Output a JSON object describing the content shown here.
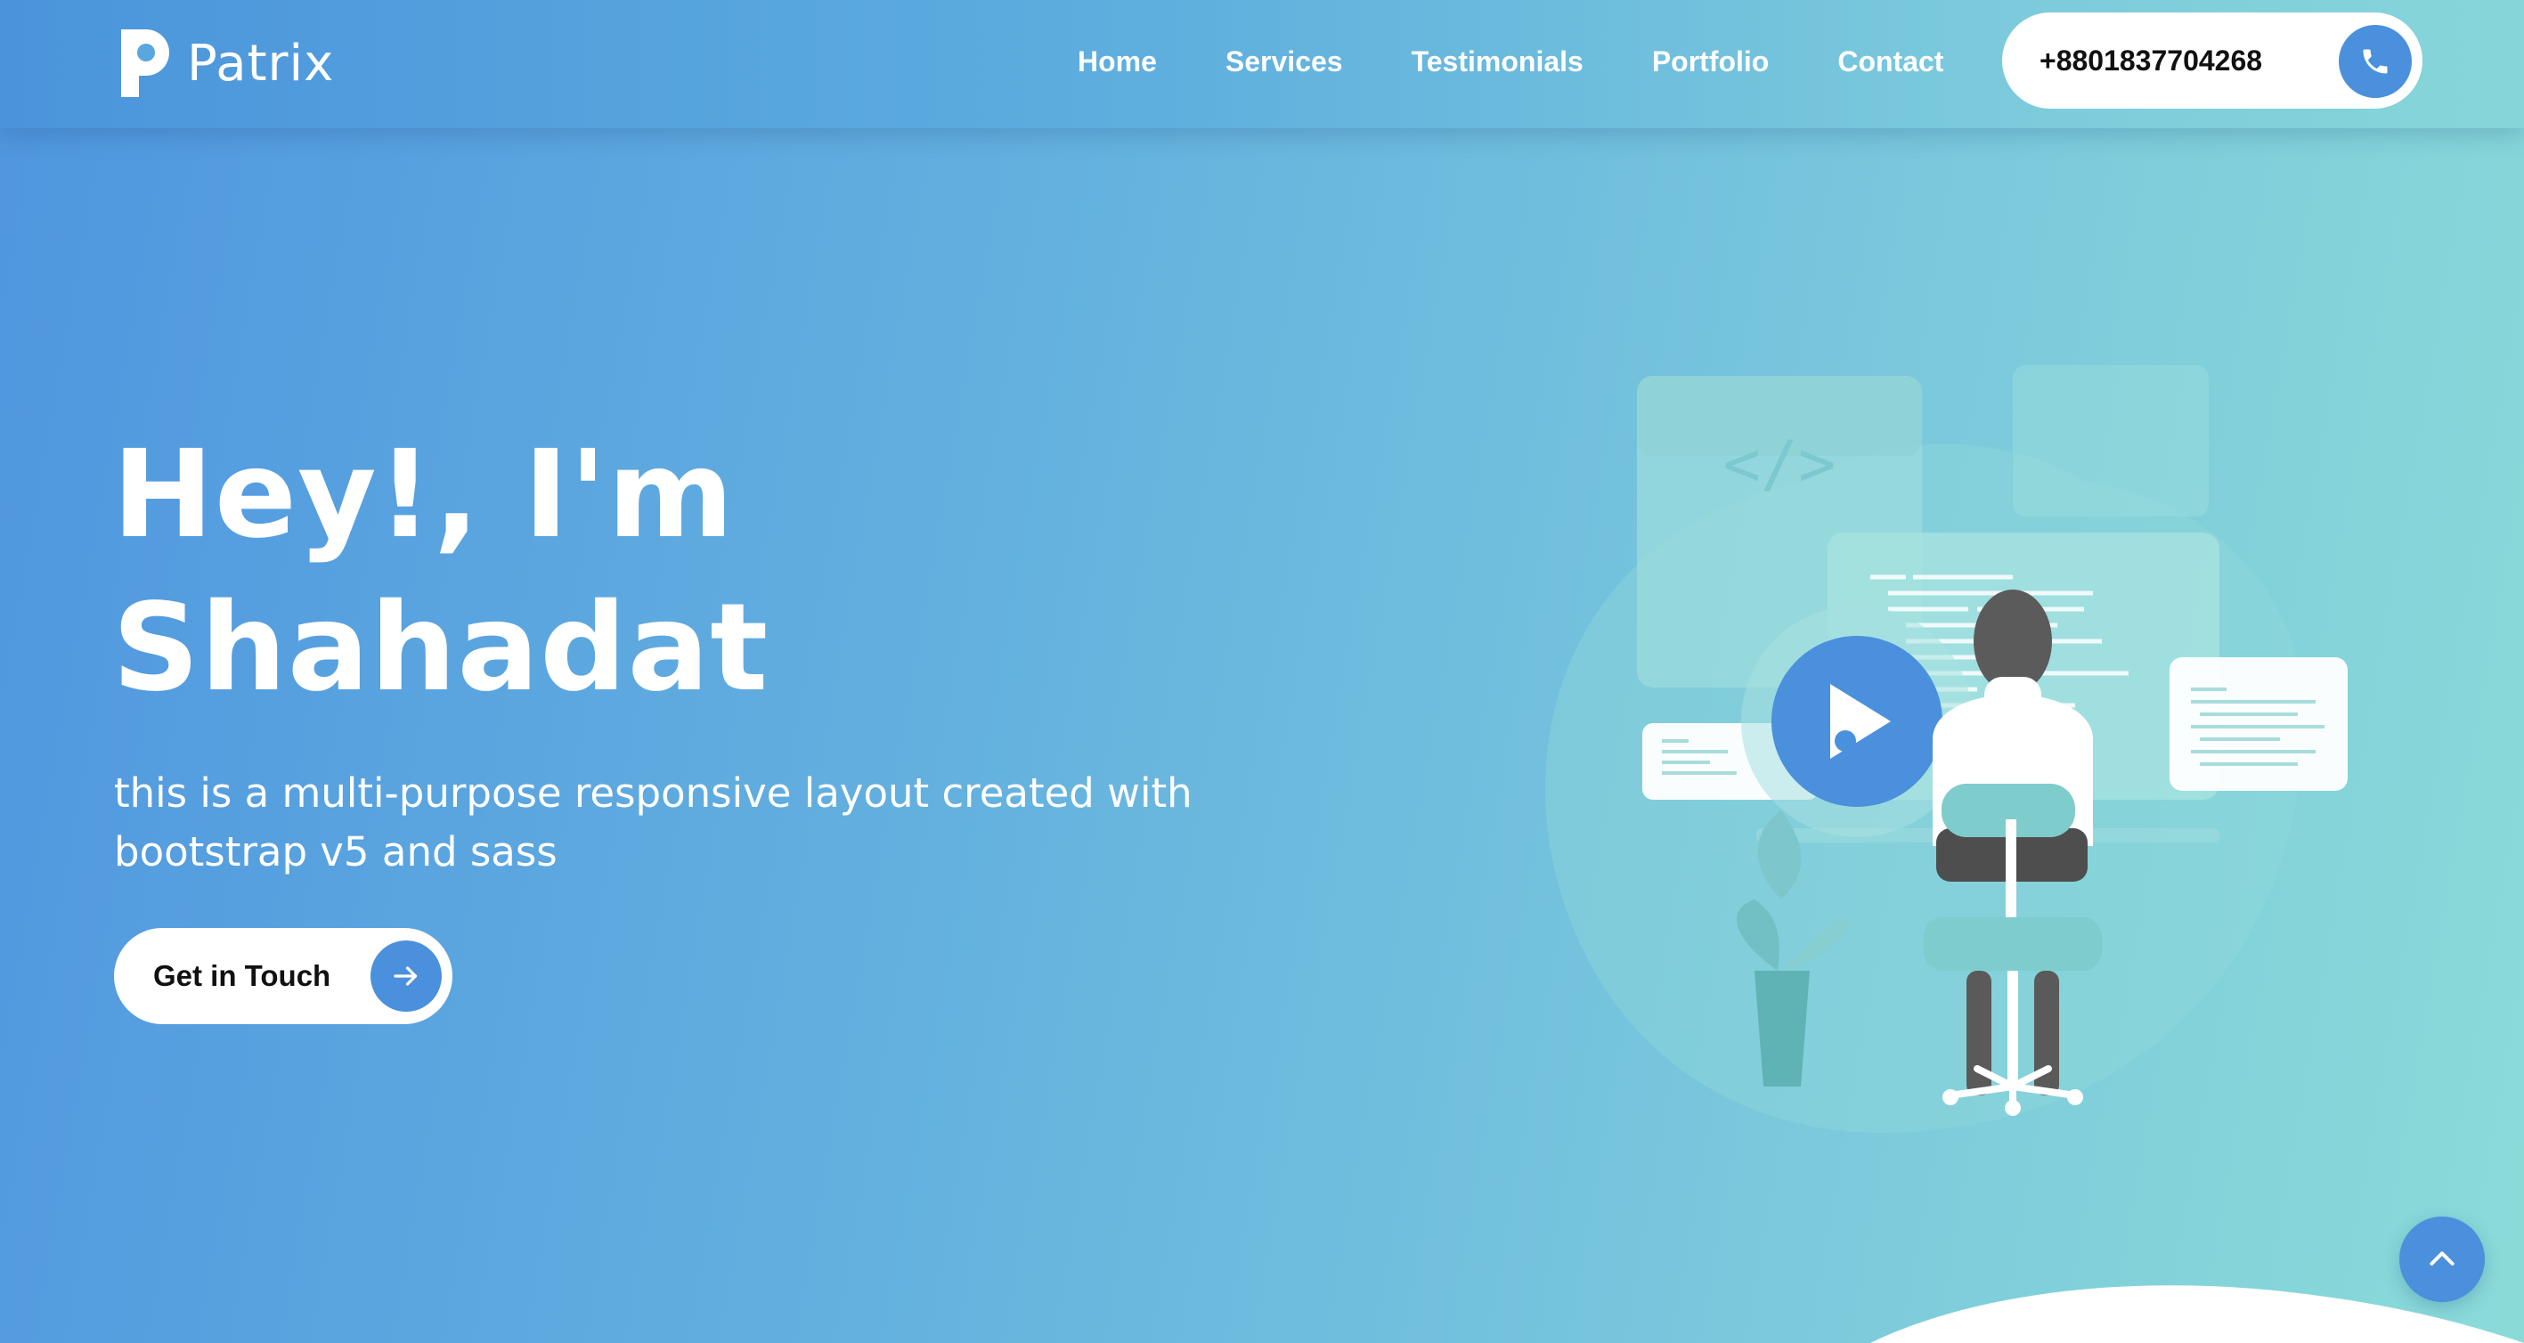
{
  "brand": {
    "name": "Patrix",
    "logo_icon": "letter-p-logo-icon"
  },
  "nav": {
    "items": [
      {
        "label": "Home"
      },
      {
        "label": "Services"
      },
      {
        "label": "Testimonials"
      },
      {
        "label": "Portfolio"
      },
      {
        "label": "Contact"
      }
    ],
    "phone": {
      "number": "+8801837704268",
      "icon": "phone-icon"
    }
  },
  "hero": {
    "title_line1": "Hey!, I'm",
    "title_line2": "Shahadat",
    "subtitle": "this is a multi-purpose responsive layout created with bootstrap v5 and sass",
    "cta_label": "Get in Touch",
    "cta_icon": "arrow-right-icon",
    "illustration": "developer-at-desk-illustration",
    "video_icon": "play-icon"
  },
  "scroll_top_icon": "chevron-up-icon",
  "colors": {
    "accent": "#4a90dc",
    "gradient_start": "#4f96df",
    "gradient_end": "#8adbd8",
    "text": "#ffffff"
  }
}
